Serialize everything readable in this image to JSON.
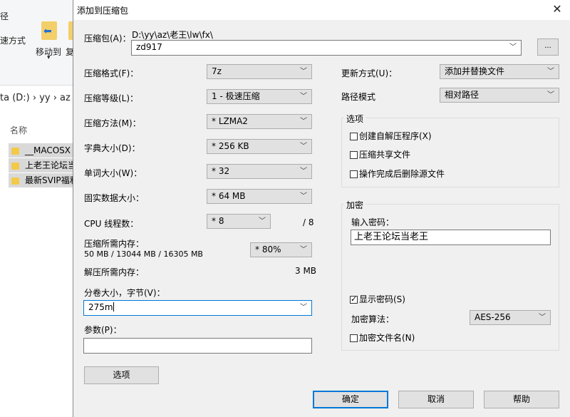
{
  "explorer": {
    "ribbon": {
      "path_fragment": "径",
      "copy_path_fragment": "速方式",
      "move_to_label": "移动到",
      "copy_to_fragment": "复"
    },
    "address_fragment": "ta (D:)  ›  yy  ›  az",
    "column_name": "名称",
    "files": [
      "__MACOSX",
      "上老王论坛当",
      "最新SVIP福利"
    ]
  },
  "dialog": {
    "title": "添加到压缩包",
    "close_glyph": "✕",
    "archive": {
      "label": "压缩包(A)：",
      "path": "D:\\yy\\az\\老王\\lw\\fx\\",
      "name": "zd917",
      "browse_label": "..."
    },
    "left": {
      "format_label": "压缩格式(F)：",
      "format_value": "7z",
      "level_label": "压缩等级(L)：",
      "level_value": "1 - 极速压缩",
      "method_label": "压缩方法(M)：",
      "method_value": "* LZMA2",
      "dict_label": "字典大小(D)：",
      "dict_value": "* 256 KB",
      "word_label": "单词大小(W)：",
      "word_value": "* 32",
      "solid_label": "固实数据大小：",
      "solid_value": "* 64 MB",
      "cpu_label": "CPU 线程数：",
      "cpu_value": "* 8",
      "cpu_max": "/ 8",
      "mem_label": "压缩所需内存：",
      "mem_detail": "50 MB / 13044 MB / 16305 MB",
      "mem_value": "* 80%",
      "decomp_label": "解压所需内存：",
      "decomp_value": "3 MB",
      "volume_label": "分卷大小，字节(V)：",
      "volume_value": "275m",
      "params_label": "参数(P)：",
      "params_value": "",
      "options_button": "选项"
    },
    "right": {
      "update_label": "更新方式(U)：",
      "update_value": "添加并替换文件",
      "path_label": "路径模式",
      "path_value": "相对路径",
      "options_group": "选项",
      "opt_sfx": "创建自解压程序(X)",
      "opt_shared": "压缩共享文件",
      "opt_delete": "操作完成后删除源文件",
      "encrypt_group": "加密",
      "password_label": "输入密码：",
      "password_value": "上老王论坛当老王",
      "show_password": "显示密码(S)",
      "enc_method_label": "加密算法：",
      "enc_method_value": "AES-256",
      "encrypt_names": "加密文件名(N)"
    },
    "buttons": {
      "ok": "确定",
      "cancel": "取消",
      "help": "帮助"
    }
  }
}
